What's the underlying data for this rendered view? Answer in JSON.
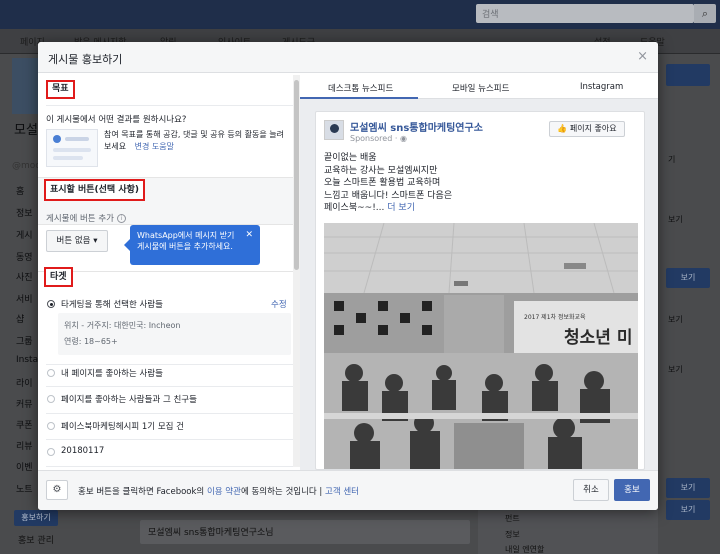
{
  "topbar": {
    "search_placeholder": "검색"
  },
  "pagebar": {
    "tabs": [
      "페이지",
      "받은 메시지함",
      "알림",
      "인사이트",
      "게시도구"
    ],
    "settings": "설정",
    "help": "도움말"
  },
  "left_col": {
    "title": "모설",
    "items": [
      "홈",
      "정보",
      "게시",
      "동영",
      "사진",
      "서비",
      "샵",
      "그룹",
      "Instag",
      "라이",
      "커뮤",
      "쿠폰",
      "리뷰",
      "이벤",
      "노트"
    ],
    "handle": "@moo",
    "promote_button": "홍보하기",
    "page_manage": "홍보 관리"
  },
  "right_col": {
    "buttons": [
      "보기",
      "보기",
      "보기"
    ],
    "texts": [
      "기",
      "보기",
      "보기",
      "보기"
    ]
  },
  "bg_post": {
    "text": "모설엠씨 sns통합마케팅연구소님"
  },
  "bg_right_list": [
    "펀트",
    "정보",
    "내일 엔연할"
  ],
  "modal": {
    "title": "게시물 홍보하기",
    "close": "×",
    "left": {
      "goal_heading": "목표",
      "goal_question": "이 게시물에서 어떤 결과를 원하시나요?",
      "goal_text": "참여 목표를 통해 공감, 댓글 및 공유 등의 활동을 늘려보세요",
      "goal_change": "변경",
      "goal_help": "도움말",
      "cta_heading": "표시할 버튼(선택 사항)",
      "cta_question": "게시물에 버튼 추가",
      "cta_button": "버튼 없음 ▾",
      "tooltip": "WhatsApp에서 메시지 받기 게시물에 버튼을 추가하세요.",
      "tooltip_close": "✕",
      "target_heading": "타겟",
      "targets": [
        {
          "label": "타게팅을 통해 선택한 사람들",
          "selected": true
        },
        {
          "label": "내 페이지를 좋아하는 사람들",
          "selected": false
        },
        {
          "label": "페이지를 좋아하는 사람들과 그 친구들",
          "selected": false
        },
        {
          "label": "페이스북마케팅헤시피 1기 모집 건",
          "selected": false
        },
        {
          "label": "20180117",
          "selected": false
        }
      ],
      "edit": "수정",
      "location": "위치 - 거주지: 대한민국: Incheon",
      "age": "연령: 18~65+"
    },
    "right": {
      "tabs": [
        "데스크톱 뉴스피드",
        "모바일 뉴스피드",
        "Instagram"
      ],
      "page_name": "모설엠씨 sns통합마케팅연구소",
      "sponsored": "Sponsored · ",
      "like_page": "페이지 좋아요",
      "post_lines": [
        "끝이없는 배움",
        "교육하는 강사는 모설엠씨지만",
        "오늘 스마트폰 활용법 교육하며",
        "느낌고 배웁니다! 스마트폰 다음은",
        "페이스북~~!..."
      ],
      "more": "더 보기",
      "photo_banner": "2017 제1차 정보화교육",
      "photo_sign": "청소년 미"
    },
    "footer": {
      "terms_before": "홍보 버튼을 클릭하면 Facebook의 ",
      "terms_link": "이용 약관",
      "terms_after": "에 동의하는 것입니다 | ",
      "support_link": "고객 센터",
      "cancel": "취소",
      "boost": "홍보"
    }
  }
}
